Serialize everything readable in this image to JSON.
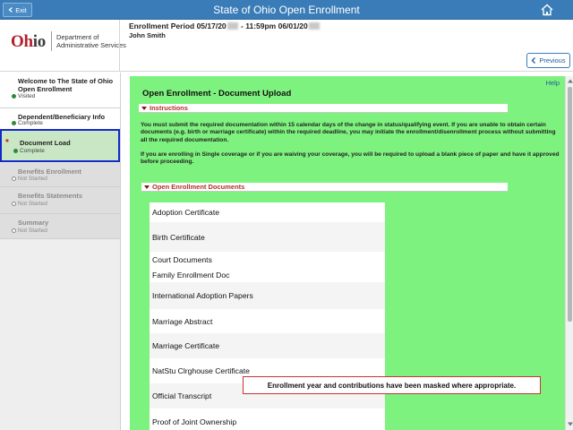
{
  "app": {
    "title": "State of Ohio Open Enrollment",
    "exit_label": "Exit"
  },
  "header": {
    "logo": {
      "word_oh": "Oh",
      "word_io": "io",
      "dept_line1": "Department of",
      "dept_line2": "Administrative Services"
    },
    "enrollment_period_prefix": "Enrollment Period 05/17/20",
    "enrollment_period_mid": " - 11:59pm 06/01/20",
    "user_name": "John Smith",
    "previous_label": "Previous"
  },
  "sidebar": {
    "items": [
      {
        "label": "Welcome to The State of Ohio Open Enrollment",
        "status": "Visited",
        "state": "done"
      },
      {
        "label": "Dependent/Beneficiary Info",
        "status": "Complete",
        "state": "done"
      },
      {
        "label": "Document Load",
        "status": "Complete",
        "state": "active"
      },
      {
        "label": "Benefits Enrollment",
        "status": "Not Started",
        "state": "disabled"
      },
      {
        "label": "Benefits Statements",
        "status": "Not Started",
        "state": "disabled"
      },
      {
        "label": "Summary",
        "status": "Not Started",
        "state": "disabled"
      }
    ]
  },
  "main": {
    "help_label": "Help",
    "page_title": "Open Enrollment - Document Upload",
    "instructions_header": "Instructions",
    "instructions_p1": "You must submit the required documentation within 15 calendar days of the change in status/qualifying event. If you are unable to obtain certain documents (e.g. birth or marriage certificate) within the required deadline, you may initiate the enrollment/disenrollment process without submitting all the required documentation.",
    "instructions_p2": "If you are enrolling in Single coverage or if you are waiving your coverage, you will be required to upload a blank piece of paper and have it approved before proceeding.",
    "documents_header": "Open Enrollment Documents",
    "documents": [
      "Adoption Certificate",
      "Birth Certificate",
      "Court Documents",
      "Family Enrollment Doc",
      "International Adoption Papers",
      "Marriage Abstract",
      "Marriage Certificate",
      "NatStu Clrghouse Certificate",
      "Official Transcript",
      "Proof of Joint Ownership"
    ]
  },
  "note": "Enrollment year and contributions have been masked where appropriate.",
  "colors": {
    "topbar": "#3a7cb8",
    "main_panel": "#7ef27e",
    "active_step": "#c9e7c4",
    "active_border": "#1428c8",
    "logo_red": "#b41f2a"
  }
}
